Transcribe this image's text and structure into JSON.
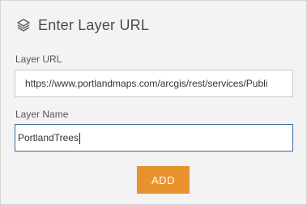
{
  "header": {
    "icon": "layers-icon",
    "title": "Enter Layer URL"
  },
  "layer_url": {
    "label": "Layer URL",
    "value": "https://www.portlandmaps.com/arcgis/rest/services/Publi"
  },
  "layer_name": {
    "label": "Layer Name",
    "value": "PortlandTrees"
  },
  "actions": {
    "add_label": "ADD"
  },
  "colors": {
    "accent": "#e8922e",
    "focus_border": "#3a68a8",
    "panel_bg": "#f3f3f3"
  }
}
